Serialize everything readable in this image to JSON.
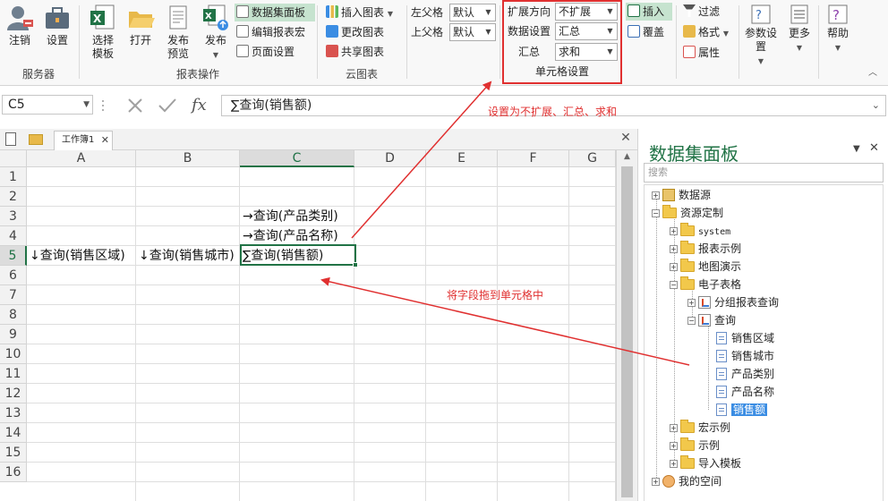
{
  "ribbon": {
    "groups": {
      "server": "服务器",
      "report_ops": "报表操作",
      "cloud_chart": "云图表",
      "cell_settings": "单元格设置"
    },
    "buttons": {
      "logout": "注销",
      "settings": "设置",
      "select_template_l1": "选择",
      "select_template_l2": "模板",
      "open": "打开",
      "publish_preview_l1": "发布",
      "publish_preview_l2": "预览",
      "publish": "发布",
      "data_panel": "数据集面板",
      "edit_macro": "编辑报表宏",
      "page_setup": "页面设置",
      "insert_chart": "插入图表",
      "change_chart": "更改图表",
      "share_chart": "共享图表",
      "left_parent": "左父格",
      "top_parent": "上父格",
      "insert": "插入",
      "overwrite": "覆盖",
      "filter": "过滤",
      "format": "格式",
      "property": "属性",
      "param_settings_l1": "参数设置",
      "more": "更多",
      "help": "帮助"
    },
    "combos": {
      "left_parent_value": "默认",
      "top_parent_value": "默认",
      "expand_direction_label": "扩展方向",
      "expand_direction_value": "不扩展",
      "data_setting_label": "数据设置",
      "data_setting_value": "汇总",
      "summary_label": "汇总",
      "summary_value": "求和"
    }
  },
  "formula_bar": {
    "cell_ref": "C5",
    "formula": "∑查询(销售额)",
    "fx": "fx"
  },
  "annotations": {
    "top": "设置为不扩展、汇总、求和",
    "middle": "将字段拖到单元格中"
  },
  "sheet": {
    "tab_name": "工作簿1",
    "columns": [
      "A",
      "B",
      "C",
      "D",
      "E",
      "F",
      "G"
    ],
    "rows": [
      "1",
      "2",
      "3",
      "4",
      "5",
      "6",
      "7",
      "8",
      "9",
      "10",
      "11",
      "12",
      "13",
      "14",
      "15",
      "16"
    ],
    "cells": {
      "C3": "→查询(产品类别)",
      "C4": "→查询(产品名称)",
      "A5": "↓查询(销售区域)",
      "B5": "↓查询(销售城市)",
      "C5": "∑查询(销售额)"
    }
  },
  "panel": {
    "title": "数据集面板",
    "search_placeholder": "搜索",
    "tree": {
      "datasource": "数据源",
      "resource": "资源定制",
      "system": "system",
      "report_examples": "报表示例",
      "map_demo": "地图演示",
      "spreadsheet": "电子表格",
      "group_query": "分组报表查询",
      "query": "查询",
      "f1": "销售区域",
      "f2": "销售城市",
      "f3": "产品类别",
      "f4": "产品名称",
      "f5": "销售额",
      "macro_examples": "宏示例",
      "examples": "示例",
      "import_template": "导入模板",
      "my_space": "我的空间"
    }
  },
  "colors": {
    "accent": "#217346",
    "annotation": "#e03030",
    "selection": "#3b8de3"
  }
}
